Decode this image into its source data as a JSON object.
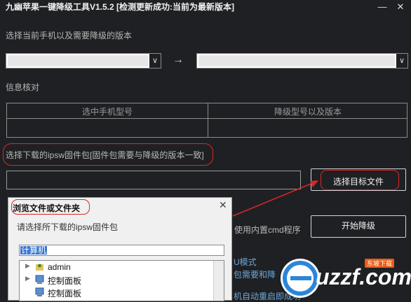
{
  "window": {
    "title": "九幽苹果一键降级工具V1.5.2 [检测更新成功:当前为最新版本]",
    "minimize_glyph": "—",
    "close_glyph": "✕"
  },
  "version_section": {
    "label": "选择当前手机以及需要降级的版本",
    "arrow": "→",
    "dropdown_glyph": "∨"
  },
  "info_section": {
    "label": "信息核对",
    "columns": [
      "选中手机型号",
      "降级型号以及版本"
    ]
  },
  "firmware_section": {
    "label": "选择下载的ipsw固件包[固件包需要与降级的版本一致]",
    "select_button": "选择目标文件"
  },
  "actions": {
    "partial_label": "使用内置cmd程序",
    "start_button": "开始降级"
  },
  "background_partial_texts": [
    "U模式",
    "包需要和降",
    "机自动重启即成功"
  ],
  "dialog": {
    "title": "浏览文件或文件夹",
    "close_glyph": "✕",
    "instruction": "请选择所下载的ipsw固件包",
    "path_value": "计算机",
    "tree_items": [
      {
        "label": "admin",
        "icon": "user-folder-icon"
      },
      {
        "label": "控制面板",
        "icon": "control-panel-icon"
      },
      {
        "label": "控制面板",
        "icon": "control-panel-icon"
      }
    ]
  },
  "watermark": {
    "text": "uzzf.com",
    "badge": "东坡下载"
  },
  "colors": {
    "background": "#1f2023",
    "annotation_red": "#d8282a",
    "selection_blue": "#3a76d0"
  }
}
